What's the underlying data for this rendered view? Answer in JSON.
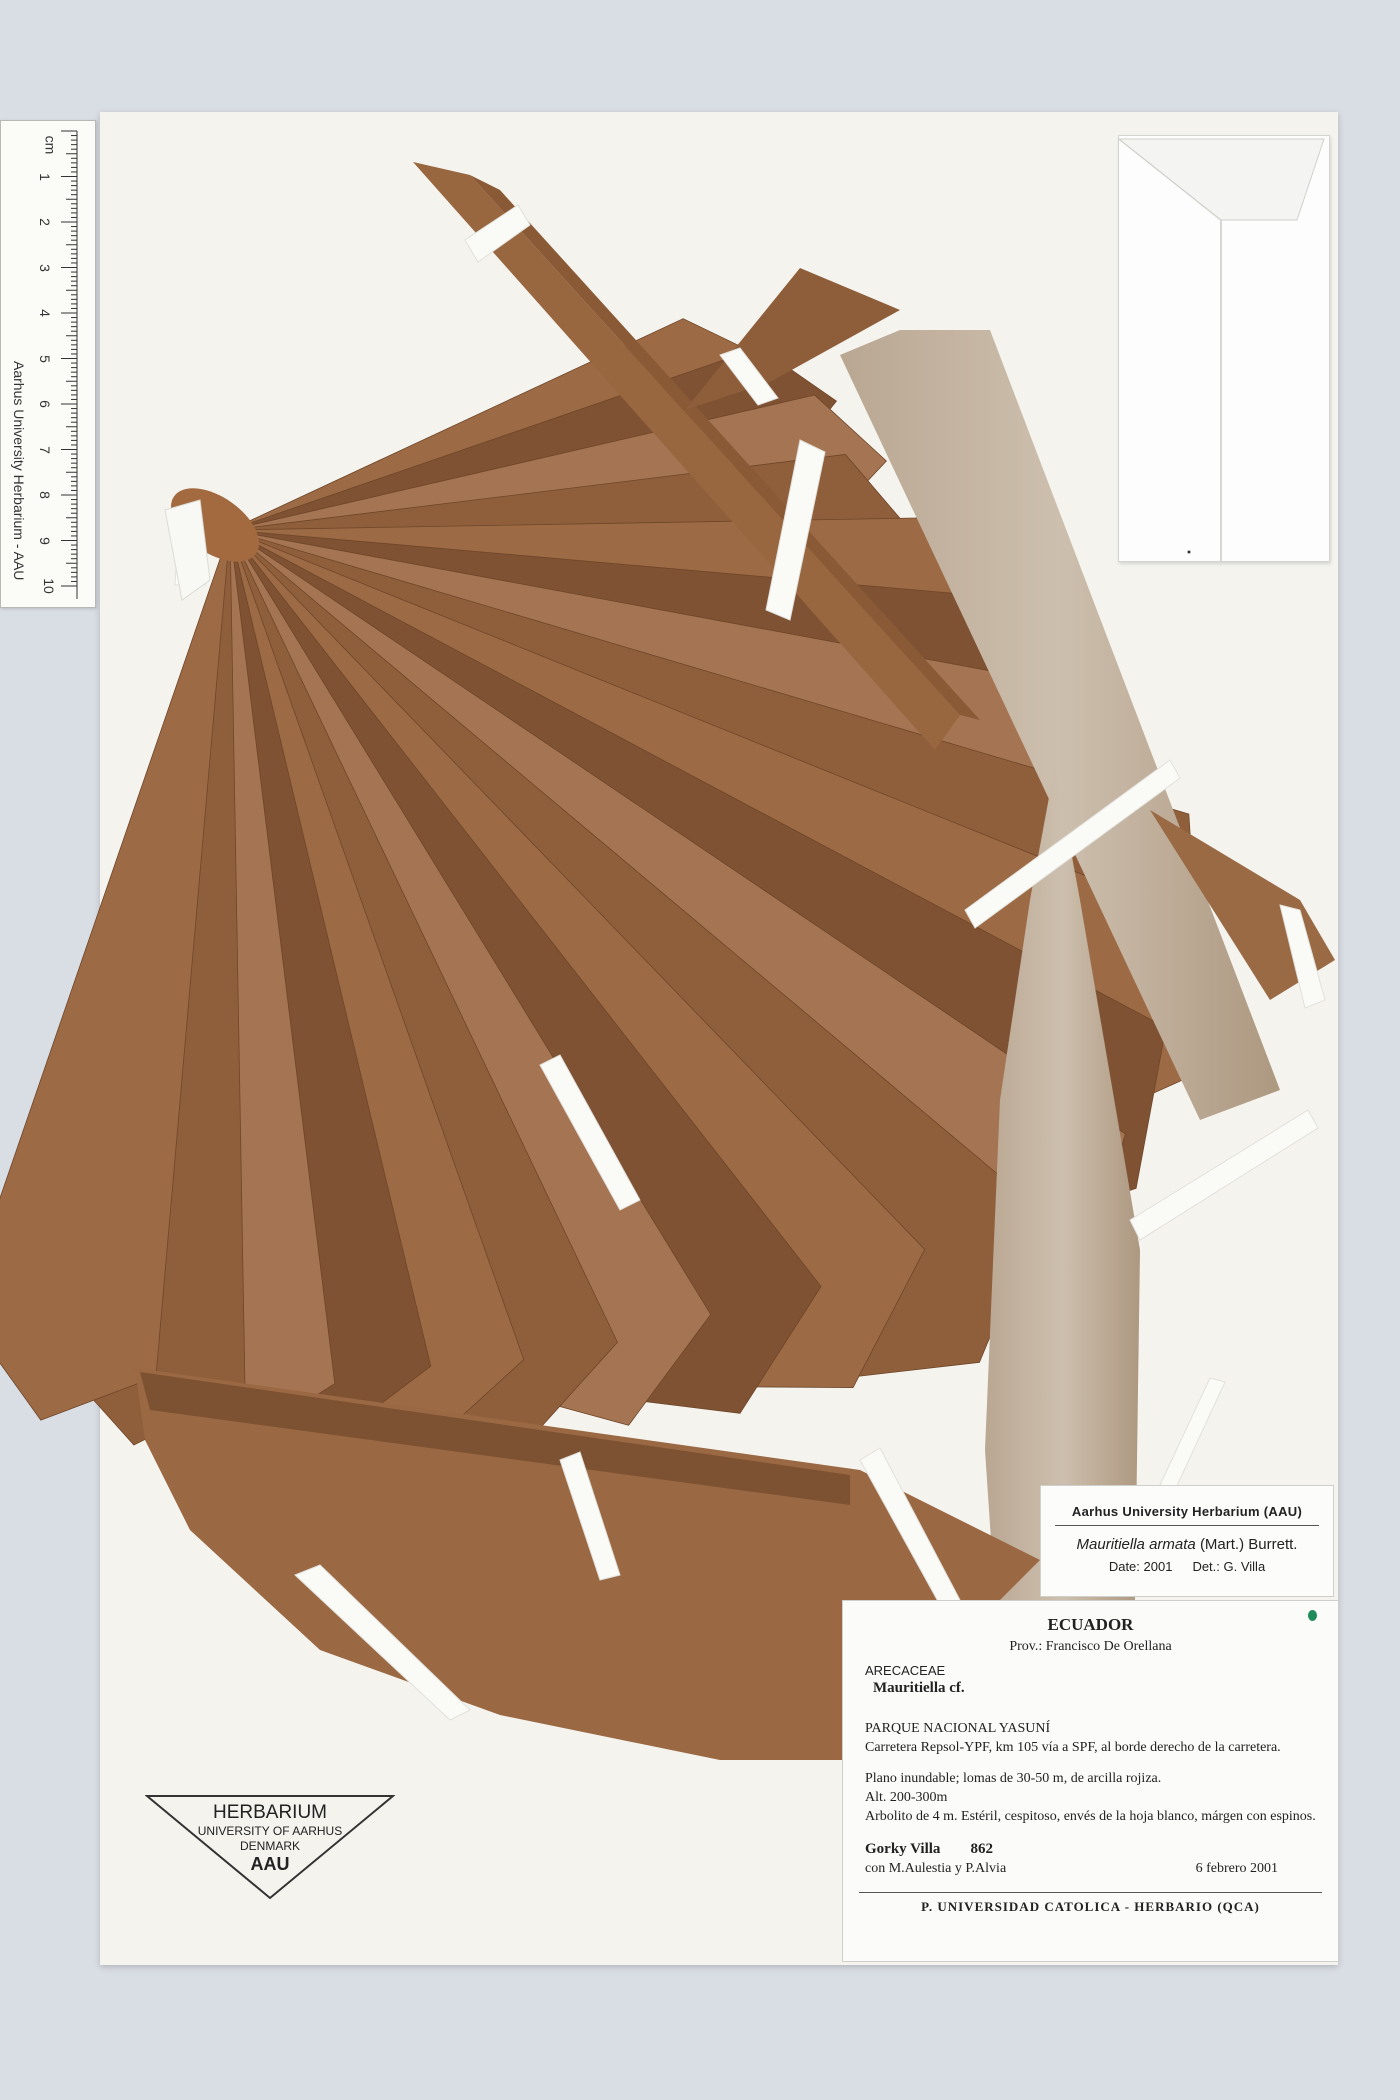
{
  "ruler": {
    "unit": "cm",
    "numbers": [
      "1",
      "2",
      "3",
      "4",
      "5",
      "6",
      "7",
      "8",
      "9",
      "10"
    ],
    "caption": "Aarhus University Herbarium - AAU"
  },
  "aau_label": {
    "header": "Aarhus University Herbarium (AAU)",
    "species": "Mauritiella armata",
    "authority": "(Mart.) Burrett.",
    "date": "Date: 2001",
    "det": "Det.: G. Villa"
  },
  "collection_label": {
    "country": "ECUADOR",
    "province": "Prov.: Francisco De Orellana",
    "family": "ARECACEAE",
    "genus": "Mauritiella cf.",
    "park": "PARQUE NACIONAL YASUNÍ",
    "locality": "Carretera Repsol-YPF, km 105 vía a SPF, al borde derecho de la carretera.",
    "habitat": "Plano inundable; lomas de 30-50 m, de arcilla rojiza.",
    "altitude": "Alt. 200-300m",
    "description": "Arbolito de 4 m. Estéril, cespitoso, envés de la hoja blanco, márgen con espinos.",
    "collector": "Gorky Villa",
    "number": "862",
    "companions": "con M.Aulestia y P.Alvia",
    "date": "6 febrero 2001",
    "institution": "P. UNIVERSIDAD CATOLICA - HERBARIO (QCA)"
  },
  "stamp": {
    "line1": "HERBARIUM",
    "line2": "UNIVERSITY OF AARHUS",
    "line3": "DENMARK",
    "line4": "AAU"
  },
  "colors": {
    "leaf": "#9c6a44",
    "leaf_dark": "#7e5233",
    "leaf_pale": "#c9b6a0",
    "tape": "#fafaf7"
  }
}
